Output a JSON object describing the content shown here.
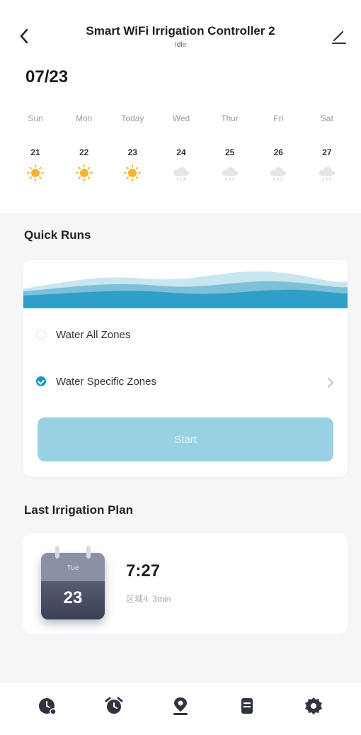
{
  "header": {
    "back_icon": "chevron-left-icon",
    "title": "Smart WiFi Irrigation Controller 2",
    "status": "Idle",
    "edit_icon": "pencil-icon"
  },
  "date": "07/23",
  "week": [
    {
      "name": "Sun",
      "num": "21",
      "weather": "sunny"
    },
    {
      "name": "Mon",
      "num": "22",
      "weather": "sunny"
    },
    {
      "name": "Today",
      "num": "23",
      "weather": "sunny"
    },
    {
      "name": "Wed",
      "num": "24",
      "weather": "rain"
    },
    {
      "name": "Thur",
      "num": "25",
      "weather": "rain"
    },
    {
      "name": "Fri",
      "num": "26",
      "weather": "rain"
    },
    {
      "name": "Sat",
      "num": "27",
      "weather": "rain"
    }
  ],
  "quick_runs": {
    "title": "Quick Runs",
    "option_all": "Water All Zones",
    "option_specific": "Water Specific Zones",
    "selected": "specific",
    "start_label": "Start"
  },
  "last_plan": {
    "title": "Last Irrigation Plan",
    "month": "Tue",
    "day": "23",
    "time": "7:27",
    "duration": "区域4: 3min"
  },
  "tabs": [
    "schedule-clock-icon",
    "alarm-clock-icon",
    "location-pin-icon",
    "list-icon",
    "settings-gear-icon"
  ],
  "colors": {
    "accent": "#1b94c4",
    "start_button": "#99d1e4",
    "sun": "#f6b530"
  }
}
